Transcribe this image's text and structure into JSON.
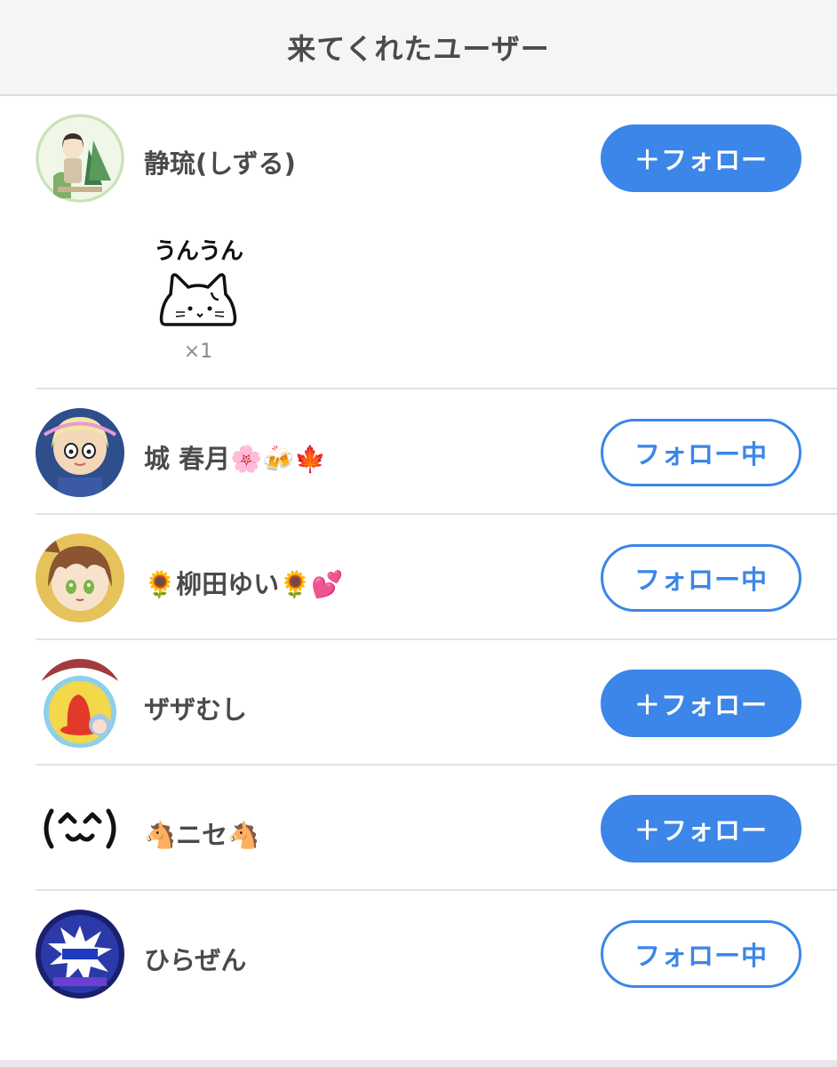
{
  "header": {
    "title": "来てくれたユーザー"
  },
  "users": [
    {
      "name": "静琉(しずる)",
      "button": "＋フォロー",
      "state": "follow",
      "avatar": "girl-avatar"
    },
    {
      "name": "城 春月🌸🍻🍁",
      "button": "フォロー中",
      "state": "following",
      "avatar": "anime-girl-avatar"
    },
    {
      "name": "🌻柳田ゆい🌻💕",
      "button": "フォロー中",
      "state": "following",
      "avatar": "brown-hair-avatar"
    },
    {
      "name": "ザザむし",
      "button": "＋フォロー",
      "state": "follow",
      "avatar": "red-character-avatar"
    },
    {
      "name": "🐴ニセ🐴",
      "button": "＋フォロー",
      "state": "follow",
      "avatar": "kaomoji-avatar"
    },
    {
      "name": "ひらぜん",
      "button": "フォロー中",
      "state": "following",
      "avatar": "blue-burst-avatar"
    }
  ],
  "stamp": {
    "text": "うんうん",
    "count": "×1",
    "icon": "cat-stamp-icon"
  },
  "colors": {
    "accent": "#3b86e8",
    "header_bg": "#f5f5f7",
    "text": "#4a4a4a"
  }
}
